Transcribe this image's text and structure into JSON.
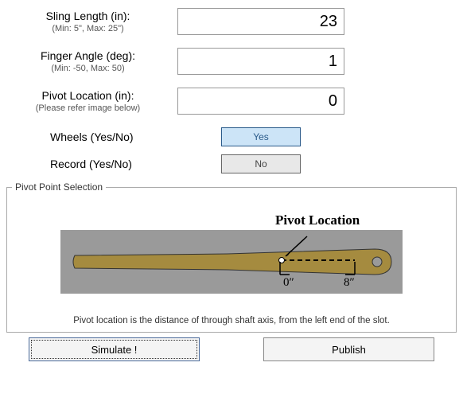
{
  "fields": {
    "sling": {
      "label": "Sling Length (in):",
      "hint": "(Min: 5\", Max: 25\")",
      "value": "23"
    },
    "finger": {
      "label": "Finger Angle (deg):",
      "hint": "(Min: -50, Max: 50)",
      "value": "1"
    },
    "pivot": {
      "label": "Pivot Location (in):",
      "hint": "(Please refer image below)",
      "value": "0"
    }
  },
  "toggles": {
    "wheels": {
      "label": "Wheels (Yes/No)",
      "value": "Yes"
    },
    "record": {
      "label": "Record (Yes/No)",
      "value": "No"
    }
  },
  "pivot_section": {
    "legend": "Pivot Point Selection",
    "diagram_title": "Pivot Location",
    "tick0": "0″",
    "tick8": "8″",
    "caption": "Pivot location is the distance of through shaft axis, from the left end of the slot."
  },
  "buttons": {
    "simulate": "Simulate !",
    "publish": "Publish"
  }
}
